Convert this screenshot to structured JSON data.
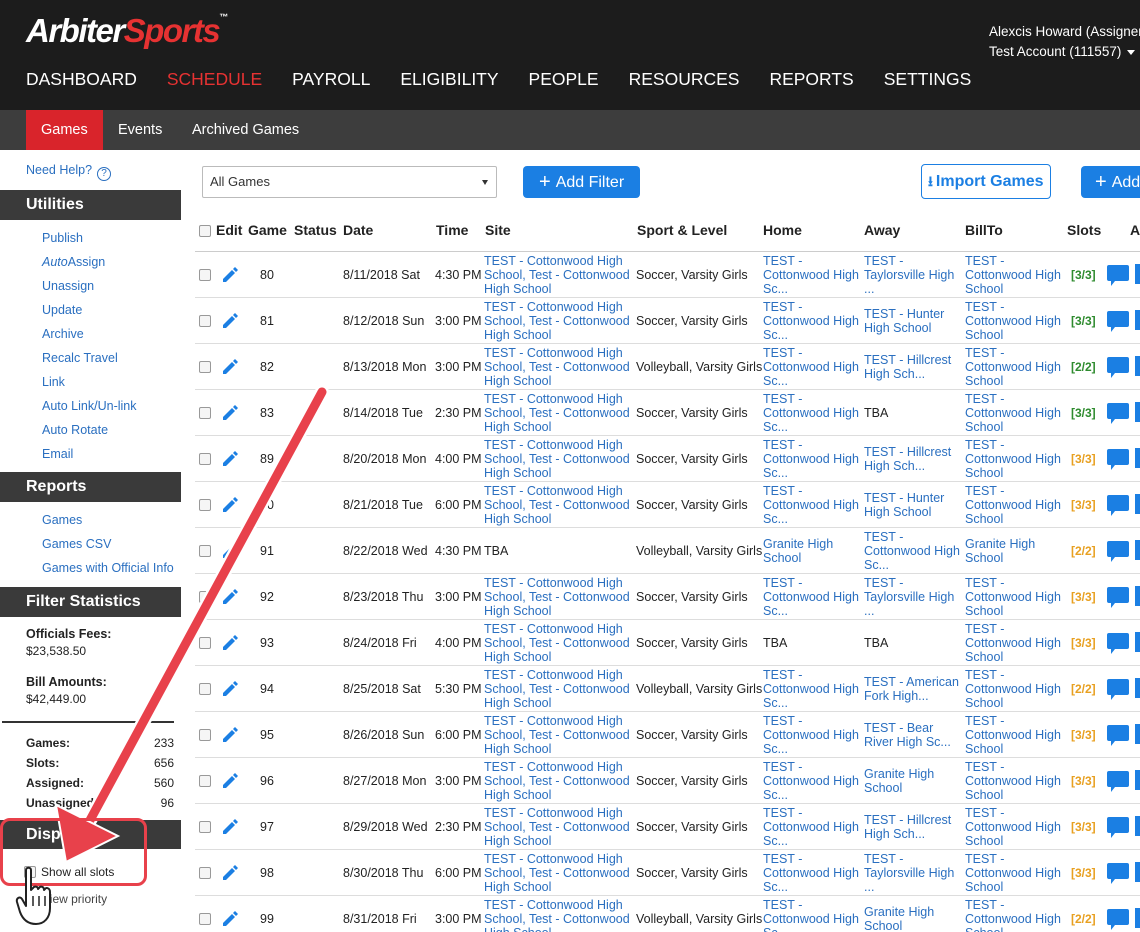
{
  "logo": {
    "part1": "Arbiter",
    "part2": "Sports",
    "tm": "™"
  },
  "account": {
    "name": "Alexcis Howard (Assigner)",
    "account": "Test Account (111557)"
  },
  "main_nav": [
    {
      "label": "DASHBOARD",
      "active": false
    },
    {
      "label": "SCHEDULE",
      "active": true
    },
    {
      "label": "PAYROLL",
      "active": false
    },
    {
      "label": "ELIGIBILITY",
      "active": false
    },
    {
      "label": "PEOPLE",
      "active": false
    },
    {
      "label": "RESOURCES",
      "active": false
    },
    {
      "label": "REPORTS",
      "active": false
    },
    {
      "label": "SETTINGS",
      "active": false
    }
  ],
  "sub_nav": [
    {
      "label": "Games",
      "active": true
    },
    {
      "label": "Events",
      "active": false
    },
    {
      "label": "Archived Games",
      "active": false
    }
  ],
  "sidebar": {
    "help": "Need Help?",
    "utilities_title": "Utilities",
    "utilities": [
      "Publish",
      "AutoAssign",
      "Unassign",
      "Update",
      "Archive",
      "Recalc Travel",
      "Link",
      "Auto Link/Un-link",
      "Auto Rotate",
      "Email"
    ],
    "reports_title": "Reports",
    "reports": [
      "Games",
      "Games CSV",
      "Games with Official Info"
    ],
    "filter_title": "Filter Statistics",
    "officials_fees_label": "Officials Fees:",
    "officials_fees": "$23,538.50",
    "bill_amounts_label": "Bill Amounts:",
    "bill_amounts": "$42,449.00",
    "stats": [
      {
        "label": "Games:",
        "value": "233"
      },
      {
        "label": "Slots:",
        "value": "656"
      },
      {
        "label": "Assigned:",
        "value": "560"
      },
      {
        "label": "Unassigned:",
        "value": "96"
      }
    ],
    "display_title": "Display",
    "show_all_slots": "Show all slots",
    "view_priority": "View priority"
  },
  "toolbar": {
    "filter_select": "All Games",
    "add_filter": "Add Filter",
    "import_games": "Import Games",
    "add_partial": "Add"
  },
  "columns": [
    "Edit",
    "Game",
    "Status",
    "Date",
    "Time",
    "Site",
    "Sport & Level",
    "Home",
    "Away",
    "BillTo",
    "Slots",
    "A"
  ],
  "games": [
    {
      "game": "80",
      "date": "8/11/2018 Sat",
      "time": "4:30 PM",
      "site": [
        "TEST - Cottonwood High",
        "School, Test - Cottonwood",
        "High School"
      ],
      "sport": "Soccer, Varsity Girls",
      "home": [
        "TEST -",
        "Cottonwood High",
        "Sc..."
      ],
      "away": [
        "TEST -",
        "Taylorsville High",
        "..."
      ],
      "billto": [
        "TEST -",
        "Cottonwood High",
        "School"
      ],
      "slots": "[3/3]",
      "slot_color": "#2e8b2e"
    },
    {
      "game": "81",
      "date": "8/12/2018 Sun",
      "time": "3:00 PM",
      "site": [
        "TEST - Cottonwood High",
        "School, Test - Cottonwood",
        "High School"
      ],
      "sport": "Soccer, Varsity Girls",
      "home": [
        "TEST -",
        "Cottonwood High",
        "Sc..."
      ],
      "away": [
        "TEST - Hunter",
        "High School"
      ],
      "billto": [
        "TEST -",
        "Cottonwood High",
        "School"
      ],
      "slots": "[3/3]",
      "slot_color": "#2e8b2e"
    },
    {
      "game": "82",
      "date": "8/13/2018 Mon",
      "time": "3:00 PM",
      "site": [
        "TEST - Cottonwood High",
        "School, Test - Cottonwood",
        "High School"
      ],
      "sport": "Volleyball, Varsity Girls",
      "home": [
        "TEST -",
        "Cottonwood High",
        "Sc..."
      ],
      "away": [
        "TEST - Hillcrest",
        "High Sch..."
      ],
      "billto": [
        "TEST -",
        "Cottonwood High",
        "School"
      ],
      "slots": "[2/2]",
      "slot_color": "#2e8b2e"
    },
    {
      "game": "83",
      "date": "8/14/2018 Tue",
      "time": "2:30 PM",
      "site": [
        "TEST - Cottonwood High",
        "School, Test - Cottonwood",
        "High School"
      ],
      "sport": "Soccer, Varsity Girls",
      "home": [
        "TEST -",
        "Cottonwood High",
        "Sc..."
      ],
      "away_plain": "TBA",
      "billto": [
        "TEST -",
        "Cottonwood High",
        "School"
      ],
      "slots": "[3/3]",
      "slot_color": "#2e8b2e"
    },
    {
      "game": "89",
      "date": "8/20/2018 Mon",
      "time": "4:00 PM",
      "site": [
        "TEST - Cottonwood High",
        "School, Test - Cottonwood",
        "High School"
      ],
      "sport": "Soccer, Varsity Girls",
      "home": [
        "TEST -",
        "Cottonwood High",
        "Sc..."
      ],
      "away": [
        "TEST - Hillcrest",
        "High Sch..."
      ],
      "billto": [
        "TEST -",
        "Cottonwood High",
        "School"
      ],
      "slots": "[3/3]",
      "slot_color": "#e8a020"
    },
    {
      "game": "90",
      "date": "8/21/2018 Tue",
      "time": "6:00 PM",
      "site": [
        "TEST - Cottonwood High",
        "School, Test - Cottonwood",
        "High School"
      ],
      "sport": "Soccer, Varsity Girls",
      "home": [
        "TEST -",
        "Cottonwood High",
        "Sc..."
      ],
      "away": [
        "TEST - Hunter",
        "High School"
      ],
      "billto": [
        "TEST -",
        "Cottonwood High",
        "School"
      ],
      "slots": "[3/3]",
      "slot_color": "#e8a020"
    },
    {
      "game": "91",
      "date": "8/22/2018 Wed",
      "time": "4:30 PM",
      "site_plain": "TBA",
      "sport": "Volleyball, Varsity Girls",
      "home": [
        "Granite High",
        "School"
      ],
      "away": [
        "TEST -",
        "Cottonwood High",
        "Sc..."
      ],
      "billto": [
        "Granite High",
        "School"
      ],
      "slots": "[2/2]",
      "slot_color": "#e8a020"
    },
    {
      "game": "92",
      "date": "8/23/2018 Thu",
      "time": "3:00 PM",
      "site": [
        "TEST - Cottonwood High",
        "School, Test - Cottonwood",
        "High School"
      ],
      "sport": "Soccer, Varsity Girls",
      "home": [
        "TEST -",
        "Cottonwood High",
        "Sc..."
      ],
      "away": [
        "TEST -",
        "Taylorsville High",
        "..."
      ],
      "billto": [
        "TEST -",
        "Cottonwood High",
        "School"
      ],
      "slots": "[3/3]",
      "slot_color": "#e8a020"
    },
    {
      "game": "93",
      "date": "8/24/2018 Fri",
      "time": "4:00 PM",
      "site": [
        "TEST - Cottonwood High",
        "School, Test - Cottonwood",
        "High School"
      ],
      "sport": "Soccer, Varsity Girls",
      "home_plain": "TBA",
      "away_plain": "TBA",
      "billto": [
        "TEST -",
        "Cottonwood High",
        "School"
      ],
      "slots": "[3/3]",
      "slot_color": "#e8a020"
    },
    {
      "game": "94",
      "date": "8/25/2018 Sat",
      "time": "5:30 PM",
      "site": [
        "TEST - Cottonwood High",
        "School, Test - Cottonwood",
        "High School"
      ],
      "sport": "Volleyball, Varsity Girls",
      "home": [
        "TEST -",
        "Cottonwood High",
        "Sc..."
      ],
      "away": [
        "TEST - American",
        "Fork High..."
      ],
      "billto": [
        "TEST -",
        "Cottonwood High",
        "School"
      ],
      "slots": "[2/2]",
      "slot_color": "#e8a020"
    },
    {
      "game": "95",
      "date": "8/26/2018 Sun",
      "time": "6:00 PM",
      "site": [
        "TEST - Cottonwood High",
        "School, Test - Cottonwood",
        "High School"
      ],
      "sport": "Soccer, Varsity Girls",
      "home": [
        "TEST -",
        "Cottonwood High",
        "Sc..."
      ],
      "away": [
        "TEST - Bear",
        "River High Sc..."
      ],
      "billto": [
        "TEST -",
        "Cottonwood High",
        "School"
      ],
      "slots": "[3/3]",
      "slot_color": "#e8a020"
    },
    {
      "game": "96",
      "date": "8/27/2018 Mon",
      "time": "3:00 PM",
      "site": [
        "TEST - Cottonwood High",
        "School, Test - Cottonwood",
        "High School"
      ],
      "sport": "Soccer, Varsity Girls",
      "home": [
        "TEST -",
        "Cottonwood High",
        "Sc..."
      ],
      "away": [
        "Granite High",
        "School"
      ],
      "billto": [
        "TEST -",
        "Cottonwood High",
        "School"
      ],
      "slots": "[3/3]",
      "slot_color": "#e8a020"
    },
    {
      "game": "97",
      "date": "8/29/2018 Wed",
      "time": "2:30 PM",
      "site": [
        "TEST - Cottonwood High",
        "School, Test - Cottonwood",
        "High School"
      ],
      "sport": "Soccer, Varsity Girls",
      "home": [
        "TEST -",
        "Cottonwood High",
        "Sc..."
      ],
      "away": [
        "TEST - Hillcrest",
        "High Sch..."
      ],
      "billto": [
        "TEST -",
        "Cottonwood High",
        "School"
      ],
      "slots": "[3/3]",
      "slot_color": "#e8a020"
    },
    {
      "game": "98",
      "date": "8/30/2018 Thu",
      "time": "6:00 PM",
      "site": [
        "TEST - Cottonwood High",
        "School, Test - Cottonwood",
        "High School"
      ],
      "sport": "Soccer, Varsity Girls",
      "home": [
        "TEST -",
        "Cottonwood High",
        "Sc..."
      ],
      "away": [
        "TEST -",
        "Taylorsville High",
        "..."
      ],
      "billto": [
        "TEST -",
        "Cottonwood High",
        "School"
      ],
      "slots": "[3/3]",
      "slot_color": "#e8a020"
    },
    {
      "game": "99",
      "date": "8/31/2018 Fri",
      "time": "3:00 PM",
      "site": [
        "TEST - Cottonwood High",
        "School, Test - Cottonwood",
        "High School"
      ],
      "sport": "Volleyball, Varsity Girls",
      "home": [
        "TEST -",
        "Cottonwood High",
        "Sc..."
      ],
      "away": [
        "Granite High",
        "School"
      ],
      "billto": [
        "TEST -",
        "Cottonwood High",
        "School"
      ],
      "slots": "[2/2]",
      "slot_color": "#e8a020"
    }
  ],
  "colors": {
    "brand_red": "#e63232",
    "link_blue": "#2a6fc0",
    "button_blue": "#1b7fe3",
    "annotation_red": "#e8414b"
  },
  "icons": [
    "question-icon",
    "plus-icon",
    "import-icon",
    "pencil-icon",
    "chat-icon",
    "pointer-hand-icon"
  ]
}
